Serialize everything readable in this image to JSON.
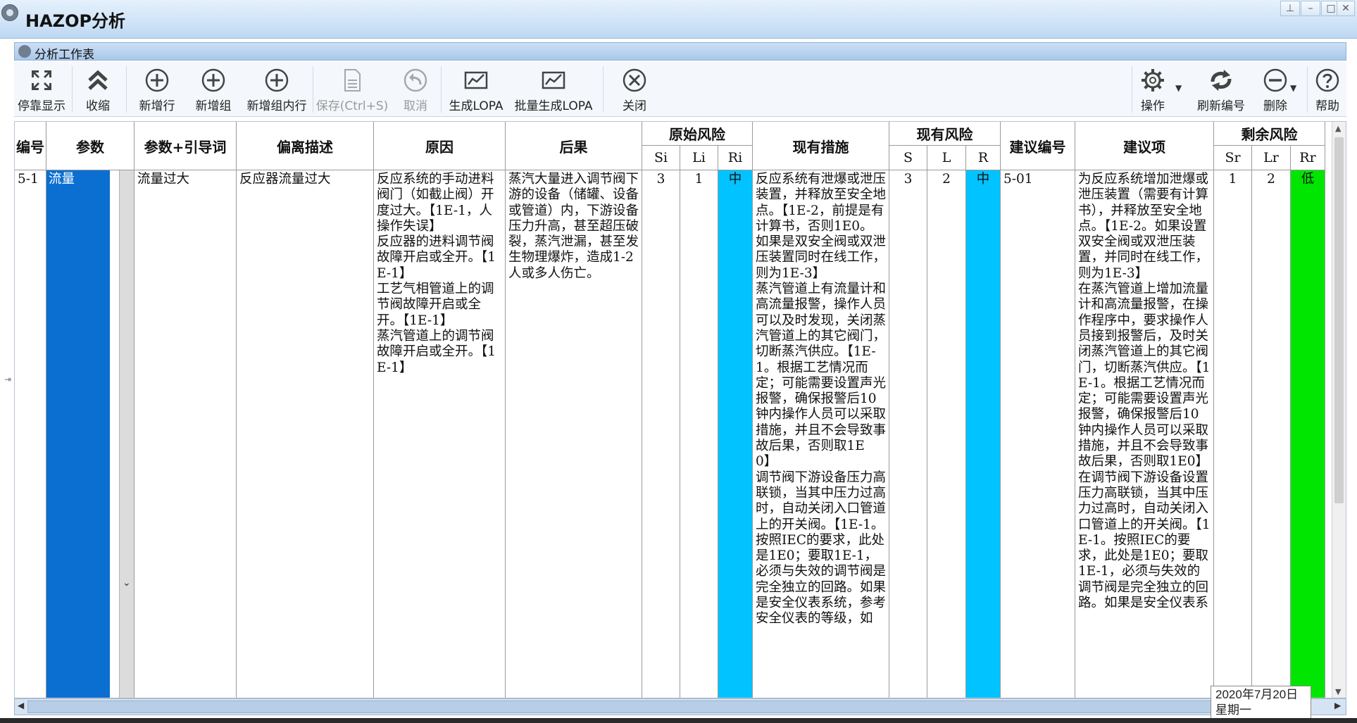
{
  "window": {
    "title": "HAZOP分析",
    "controls": [
      "pin",
      "minimize",
      "maximize",
      "close"
    ]
  },
  "panel": {
    "title": "分析工作表"
  },
  "toolbar": {
    "left": [
      {
        "label": "停靠显示",
        "icon": "dock-collapse-icon",
        "enabled": true
      },
      {
        "label": "收缩",
        "icon": "double-chevron-up-icon",
        "enabled": true
      },
      {
        "label": "新增行",
        "icon": "plus-circle-icon",
        "enabled": true
      },
      {
        "label": "新增组",
        "icon": "plus-circle-icon",
        "enabled": true
      },
      {
        "label": "新增组内行",
        "icon": "plus-circle-icon",
        "enabled": true
      },
      {
        "label": "保存(Ctrl+S)",
        "icon": "save-icon",
        "enabled": false
      },
      {
        "label": "取消",
        "icon": "undo-icon",
        "enabled": false
      },
      {
        "label": "生成LOPA",
        "icon": "chart-icon",
        "enabled": true
      },
      {
        "label": "批量生成LOPA",
        "icon": "chart-icon",
        "enabled": true
      },
      {
        "label": "关闭",
        "icon": "close-circle-icon",
        "enabled": true
      }
    ],
    "right": [
      {
        "label": "操作",
        "icon": "gear-icon",
        "dropdown": true
      },
      {
        "label": "刷新编号",
        "icon": "refresh-icon",
        "dropdown": false
      },
      {
        "label": "删除",
        "icon": "minus-circle-icon",
        "dropdown": true
      },
      {
        "label": "帮助",
        "icon": "help-icon",
        "dropdown": false
      }
    ]
  },
  "grid": {
    "headers": {
      "id": "编号",
      "param": "参数",
      "param_guide": "参数+引导词",
      "deviation": "偏离描述",
      "cause": "原因",
      "consequence": "后果",
      "orig_risk": "原始风险",
      "orig_sub": [
        "Si",
        "Li",
        "Ri"
      ],
      "measures": "现有措施",
      "curr_risk": "现有风险",
      "curr_sub": [
        "S",
        "L",
        "R"
      ],
      "rec_id": "建议编号",
      "rec": "建议项",
      "resid_risk": "剩余风险",
      "resid_sub": [
        "Sr",
        "Lr",
        "Rr"
      ]
    },
    "row": {
      "id": "5-1",
      "param": "流量",
      "param_guide": "流量过大",
      "deviation": "反应器流量过大",
      "cause": "反应系统的手动进料阀门（如截止阀）开度过大。【1E-1，人操作失误】\n反应器的进料调节阀故障开启或全开。【1E-1】\n工艺气相管道上的调节阀故障开启或全开。【1E-1】\n蒸汽管道上的调节阀故障开启或全开。【1E-1】",
      "consequence": "蒸汽大量进入调节阀下游的设备（储罐、设备或管道）内，下游设备压力升高，甚至超压破裂，蒸汽泄漏，甚至发生物理爆炸，造成1-2人或多人伤亡。",
      "si": "3",
      "li": "1",
      "ri": "中",
      "measures": "反应系统有泄爆或泄压装置，并释放至安全地点。【1E-2，前提是有计算书，否则1E0。如果是双安全阀或双泄压装置同时在线工作，则为1E-3】\n蒸汽管道上有流量计和高流量报警，操作人员可以及时发现，关闭蒸汽管道上的其它阀门，切断蒸汽供应。【1E-1。根据工艺情况而定；可能需要设置声光报警，确保报警后10钟内操作人员可以采取措施，并且不会导致事故后果，否则取1E0】\n调节阀下游设备压力高联锁，当其中压力过高时，自动关闭入口管道上的开关阀。【1E-1。按照IEC的要求，此处是1E0；要取1E-1，必须与失效的调节阀是完全独立的回路。如果是安全仪表系统，参考安全仪表的等级，如",
      "s": "3",
      "l": "2",
      "r": "中",
      "rec_id": "5-01",
      "rec": "为反应系统增加泄爆或泄压装置（需要有计算书），并释放至安全地点。【1E-2。如果设置双安全阀或双泄压装置，并同时在线工作，则为1E-3】\n在蒸汽管道上增加流量计和高流量报警，在操作程序中，要求操作人员接到报警后，及时关闭蒸汽管道上的其它阀门，切断蒸汽供应。【1E-1。根据工艺情况而定；可能需要设置声光报警，确保报警后10钟内操作人员可以采取措施，并且不会导致事故后果，否则取1E0】\n在调节阀下游设备设置压力高联锁，当其中压力过高时，自动关闭入口管道上的开关阀。【1E-1。按照IEC的要求，此处是1E0；要取1E-1，必须与失效的调节阀是完全独立的回路。如果是安全仪表系",
      "sr": "1",
      "lr": "2",
      "rr": "低"
    }
  },
  "tooltip": {
    "date": "2020年7月20日",
    "weekday": "星期一"
  },
  "colors": {
    "risk_medium": "#00c3ff",
    "risk_low": "#00e600",
    "param_selected": "#0a6fd0"
  }
}
